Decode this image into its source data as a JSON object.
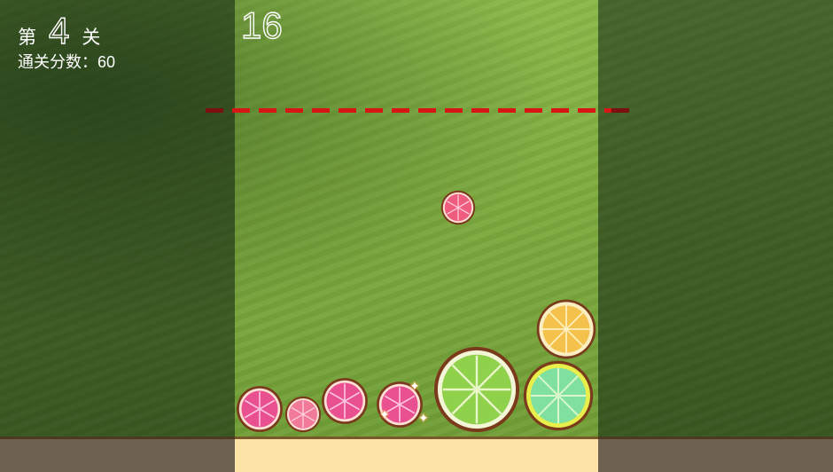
{
  "level": {
    "prefix": "第",
    "number": "4",
    "suffix": "关"
  },
  "target_score": {
    "label": "通关分数：60"
  },
  "current_score": "16",
  "colors": {
    "danger_line": "#d81515",
    "floor": "#fde3a6",
    "grapefruit": "#e9508f",
    "orange": "#f4c24c",
    "lime": "#8fd14a",
    "lemon": "#7fe0a0"
  },
  "fruits": [
    {
      "kind": "grapefruit-small",
      "icon": "grapefruit-slice-icon",
      "state": "falling"
    },
    {
      "kind": "grapefruit",
      "icon": "grapefruit-slice-icon",
      "state": "settled"
    },
    {
      "kind": "grapefruit-small",
      "icon": "grapefruit-slice-icon",
      "state": "settled"
    },
    {
      "kind": "grapefruit",
      "icon": "grapefruit-slice-icon",
      "state": "settled"
    },
    {
      "kind": "grapefruit",
      "icon": "grapefruit-slice-icon",
      "state": "merging"
    },
    {
      "kind": "lime-large",
      "icon": "lime-slice-icon",
      "state": "settled"
    },
    {
      "kind": "green-lemon",
      "icon": "lemon-slice-icon",
      "state": "settled"
    },
    {
      "kind": "orange",
      "icon": "orange-slice-icon",
      "state": "settled"
    }
  ]
}
